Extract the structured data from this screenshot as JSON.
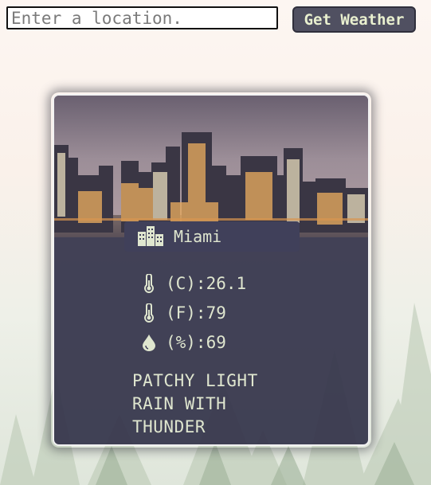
{
  "search": {
    "value": "",
    "placeholder": "Enter a location."
  },
  "actions": {
    "get_weather_label": "Get Weather"
  },
  "weather": {
    "city": "Miami",
    "city_icon": "city-buildings-icon",
    "stats": [
      {
        "icon": "thermometer-icon",
        "label": "(C):26.1"
      },
      {
        "icon": "thermometer-icon",
        "label": "(F):79"
      },
      {
        "icon": "humidity-drop-icon",
        "label": "(%):69"
      }
    ],
    "condition": "PATCHY LIGHT RAIN WITH THUNDER"
  },
  "colors": {
    "card_bg": "#34344a",
    "panel_bg": "#40405a",
    "text": "#dfe6cf",
    "button_bg": "#505061",
    "button_text": "#e9f0cf"
  }
}
